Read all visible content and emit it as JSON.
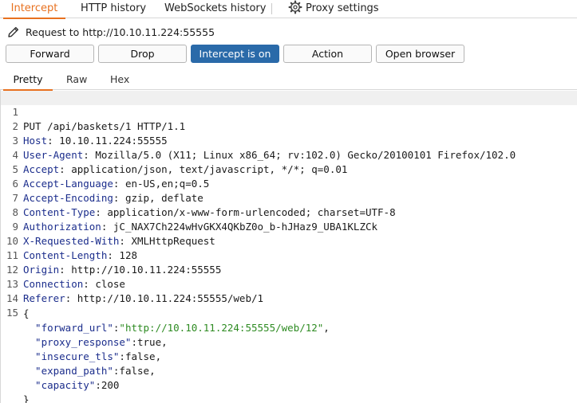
{
  "tabs": {
    "intercept": "Intercept",
    "http_history": "HTTP history",
    "websockets_history": "WebSockets history",
    "proxy_settings": "Proxy settings"
  },
  "request_info": "Request to http://10.10.11.224:55555",
  "buttons": {
    "forward": "Forward",
    "drop": "Drop",
    "intercept": "Intercept is on",
    "action": "Action",
    "open_browser": "Open browser"
  },
  "view_tabs": {
    "pretty": "Pretty",
    "raw": "Raw",
    "hex": "Hex"
  },
  "request": {
    "request_line": "PUT /api/baskets/1 HTTP/1.1",
    "headers": [
      {
        "name": "Host",
        "value": " 10.10.11.224:55555"
      },
      {
        "name": "User-Agent",
        "value": " Mozilla/5.0 (X11; Linux x86_64; rv:102.0) Gecko/20100101 Firefox/102.0"
      },
      {
        "name": "Accept",
        "value": " application/json, text/javascript, */*; q=0.01"
      },
      {
        "name": "Accept-Language",
        "value": " en-US,en;q=0.5"
      },
      {
        "name": "Accept-Encoding",
        "value": " gzip, deflate"
      },
      {
        "name": "Content-Type",
        "value": " application/x-www-form-urlencoded; charset=UTF-8"
      },
      {
        "name": "Authorization",
        "value": " jC_NAX7Ch224wHvGKX4QKbZ0o_b-hJHaz9_UBA1KLZCk"
      },
      {
        "name": "X-Requested-With",
        "value": " XMLHttpRequest"
      },
      {
        "name": "Content-Length",
        "value": " 128"
      },
      {
        "name": "Origin",
        "value": " http://10.10.11.224:55555"
      },
      {
        "name": "Connection",
        "value": " close"
      },
      {
        "name": "Referer",
        "value": " http://10.10.11.224:55555/web/1"
      }
    ],
    "body_open": "{",
    "body": [
      {
        "key": "  \"forward_url\"",
        "value": "\"http://10.10.11.224:55555/web/12\"",
        "value_type": "string",
        "trail": ","
      },
      {
        "key": "  \"proxy_response\"",
        "value": "true",
        "value_type": "literal",
        "trail": ","
      },
      {
        "key": "  \"insecure_tls\"",
        "value": "false",
        "value_type": "literal",
        "trail": ","
      },
      {
        "key": "  \"expand_path\"",
        "value": "false",
        "value_type": "literal",
        "trail": ","
      },
      {
        "key": "  \"capacity\"",
        "value": "200",
        "value_type": "literal",
        "trail": ""
      }
    ],
    "body_close": "}"
  },
  "line_numbers": [
    "1",
    "2",
    "3",
    "4",
    "5",
    "6",
    "7",
    "8",
    "9",
    "10",
    "11",
    "12",
    "13",
    "14",
    "15"
  ],
  "colors": {
    "accent": "#e8711f",
    "intercept_button_bg": "#2a6aa9",
    "header_name": "#1b2d8c",
    "json_string": "#2e8b22"
  },
  "icons": {
    "settings": "gear-icon",
    "request_edit": "pencil-icon"
  }
}
